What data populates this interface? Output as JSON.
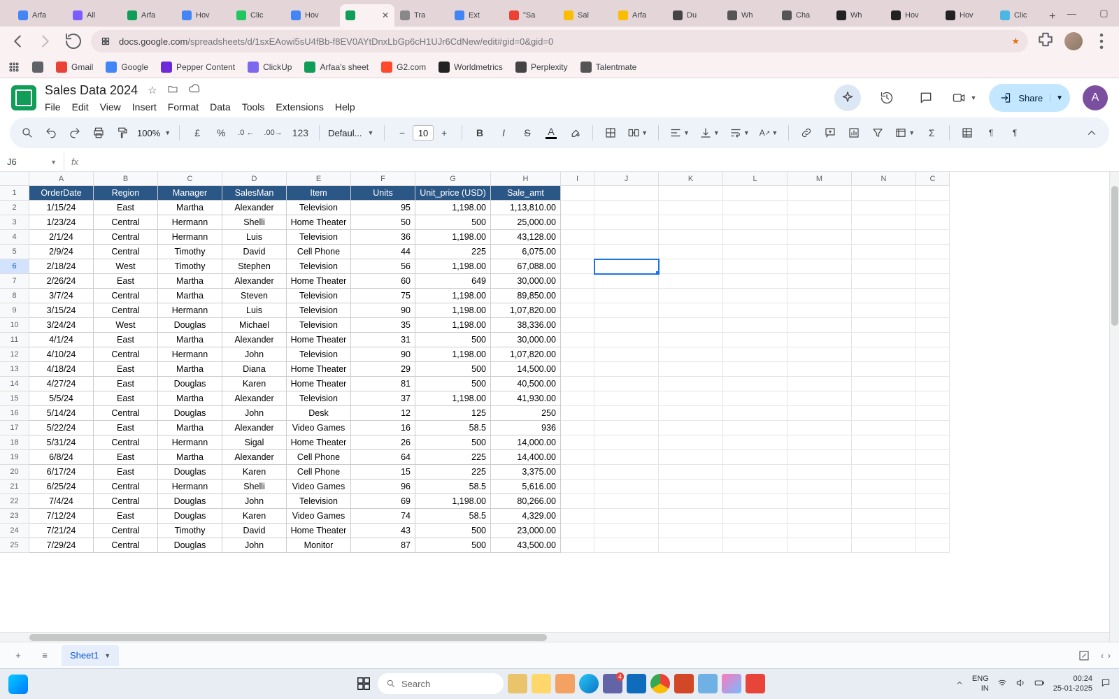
{
  "browser": {
    "tabs": [
      {
        "label": "Arfa",
        "fav": "#4285f4"
      },
      {
        "label": "All",
        "fav": "#7b5cff"
      },
      {
        "label": "Arfa",
        "fav": "#0f9d58"
      },
      {
        "label": "Hov",
        "fav": "#4285f4"
      },
      {
        "label": "Clic",
        "fav": "#22c55e"
      },
      {
        "label": "Hov",
        "fav": "#4285f4"
      },
      {
        "label": "",
        "fav": "#0f9d58",
        "active": true
      },
      {
        "label": "Tra",
        "fav": "#888"
      },
      {
        "label": "Ext",
        "fav": "#4285f4"
      },
      {
        "label": "\"Sa",
        "fav": "#ea4335"
      },
      {
        "label": "Sal",
        "fav": "#fbbc04"
      },
      {
        "label": "Arfa",
        "fav": "#fbbc04"
      },
      {
        "label": "Du",
        "fav": "#444"
      },
      {
        "label": "Wh",
        "fav": "#555"
      },
      {
        "label": "Cha",
        "fav": "#555"
      },
      {
        "label": "Wh",
        "fav": "#222"
      },
      {
        "label": "Hov",
        "fav": "#222"
      },
      {
        "label": "Hov",
        "fav": "#222"
      },
      {
        "label": "Clic",
        "fav": "#4db6e2"
      }
    ],
    "url_host": "docs.google.com",
    "url_path": "/spreadsheets/d/1sxEAowi5sU4fBb-f8EV0AYtDnxLbGp6cH1UJr6CdNew/edit#gid=0&gid=0"
  },
  "bookmarks": [
    {
      "label": "",
      "ic": "#5f6368"
    },
    {
      "label": "Gmail",
      "ic": "#ea4335"
    },
    {
      "label": "Google",
      "ic": "#4285f4"
    },
    {
      "label": "Pepper Content",
      "ic": "#6d28d9"
    },
    {
      "label": "ClickUp",
      "ic": "#7b68ee"
    },
    {
      "label": "Arfaa's sheet",
      "ic": "#0f9d58"
    },
    {
      "label": "G2.com",
      "ic": "#ff492c"
    },
    {
      "label": "Worldmetrics",
      "ic": "#222"
    },
    {
      "label": "Perplexity",
      "ic": "#444"
    },
    {
      "label": "Talentmate",
      "ic": "#555"
    }
  ],
  "doc": {
    "title": "Sales Data 2024",
    "menus": [
      "File",
      "Edit",
      "View",
      "Insert",
      "Format",
      "Data",
      "Tools",
      "Extensions",
      "Help"
    ],
    "share": "Share",
    "avatar": "A"
  },
  "toolbar": {
    "zoom": "100%",
    "currency": "£",
    "percent": "%",
    "dec_dec": ".0",
    "dec_inc": ".00",
    "numfmt": "123",
    "font_family": "Defaul...",
    "font_size": "10"
  },
  "fx": {
    "namebox": "J6",
    "formula": ""
  },
  "cols": {
    "letters": [
      "A",
      "B",
      "C",
      "D",
      "E",
      "F",
      "G",
      "H",
      "I",
      "J",
      "K",
      "L",
      "M",
      "N",
      "C"
    ],
    "widths": [
      92,
      92,
      92,
      92,
      92,
      92,
      108,
      100,
      48,
      92,
      92,
      92,
      92,
      92,
      48
    ]
  },
  "headers": [
    "OrderDate",
    "Region",
    "Manager",
    "SalesMan",
    "Item",
    "Units",
    "Unit_price (USD)",
    "Sale_amt"
  ],
  "rows": [
    [
      "1/15/24",
      "East",
      "Martha",
      "Alexander",
      "Television",
      "95",
      "1,198.00",
      "1,13,810.00"
    ],
    [
      "1/23/24",
      "Central",
      "Hermann",
      "Shelli",
      "Home Theater",
      "50",
      "500",
      "25,000.00"
    ],
    [
      "2/1/24",
      "Central",
      "Hermann",
      "Luis",
      "Television",
      "36",
      "1,198.00",
      "43,128.00"
    ],
    [
      "2/9/24",
      "Central",
      "Timothy",
      "David",
      "Cell Phone",
      "44",
      "225",
      "6,075.00"
    ],
    [
      "2/18/24",
      "West",
      "Timothy",
      "Stephen",
      "Television",
      "56",
      "1,198.00",
      "67,088.00"
    ],
    [
      "2/26/24",
      "East",
      "Martha",
      "Alexander",
      "Home Theater",
      "60",
      "649",
      "30,000.00"
    ],
    [
      "3/7/24",
      "Central",
      "Martha",
      "Steven",
      "Television",
      "75",
      "1,198.00",
      "89,850.00"
    ],
    [
      "3/15/24",
      "Central",
      "Hermann",
      "Luis",
      "Television",
      "90",
      "1,198.00",
      "1,07,820.00"
    ],
    [
      "3/24/24",
      "West",
      "Douglas",
      "Michael",
      "Television",
      "35",
      "1,198.00",
      "38,336.00"
    ],
    [
      "4/1/24",
      "East",
      "Martha",
      "Alexander",
      "Home Theater",
      "31",
      "500",
      "30,000.00"
    ],
    [
      "4/10/24",
      "Central",
      "Hermann",
      "John",
      "Television",
      "90",
      "1,198.00",
      "1,07,820.00"
    ],
    [
      "4/18/24",
      "East",
      "Martha",
      "Diana",
      "Home Theater",
      "29",
      "500",
      "14,500.00"
    ],
    [
      "4/27/24",
      "East",
      "Douglas",
      "Karen",
      "Home Theater",
      "81",
      "500",
      "40,500.00"
    ],
    [
      "5/5/24",
      "East",
      "Martha",
      "Alexander",
      "Television",
      "37",
      "1,198.00",
      "41,930.00"
    ],
    [
      "5/14/24",
      "Central",
      "Douglas",
      "John",
      "Desk",
      "12",
      "125",
      "250"
    ],
    [
      "5/22/24",
      "East",
      "Martha",
      "Alexander",
      "Video Games",
      "16",
      "58.5",
      "936"
    ],
    [
      "5/31/24",
      "Central",
      "Hermann",
      "Sigal",
      "Home Theater",
      "26",
      "500",
      "14,000.00"
    ],
    [
      "6/8/24",
      "East",
      "Martha",
      "Alexander",
      "Cell Phone",
      "64",
      "225",
      "14,400.00"
    ],
    [
      "6/17/24",
      "East",
      "Douglas",
      "Karen",
      "Cell Phone",
      "15",
      "225",
      "3,375.00"
    ],
    [
      "6/25/24",
      "Central",
      "Hermann",
      "Shelli",
      "Video Games",
      "96",
      "58.5",
      "5,616.00"
    ],
    [
      "7/4/24",
      "Central",
      "Douglas",
      "John",
      "Television",
      "69",
      "1,198.00",
      "80,266.00"
    ],
    [
      "7/12/24",
      "East",
      "Douglas",
      "Karen",
      "Video Games",
      "74",
      "58.5",
      "4,329.00"
    ],
    [
      "7/21/24",
      "Central",
      "Timothy",
      "David",
      "Home Theater",
      "43",
      "500",
      "23,000.00"
    ],
    [
      "7/29/24",
      "Central",
      "Douglas",
      "John",
      "Monitor",
      "87",
      "500",
      "43,500.00"
    ]
  ],
  "selected_row_index": 5,
  "selected_col_index": 9,
  "sheettab": {
    "add": "+",
    "menu": "≡",
    "name": "Sheet1"
  },
  "taskbar": {
    "search_placeholder": "Search",
    "lang": "ENG",
    "kb": "IN",
    "time": "00:24",
    "date": "25-01-2025",
    "teams_badge": "4"
  }
}
